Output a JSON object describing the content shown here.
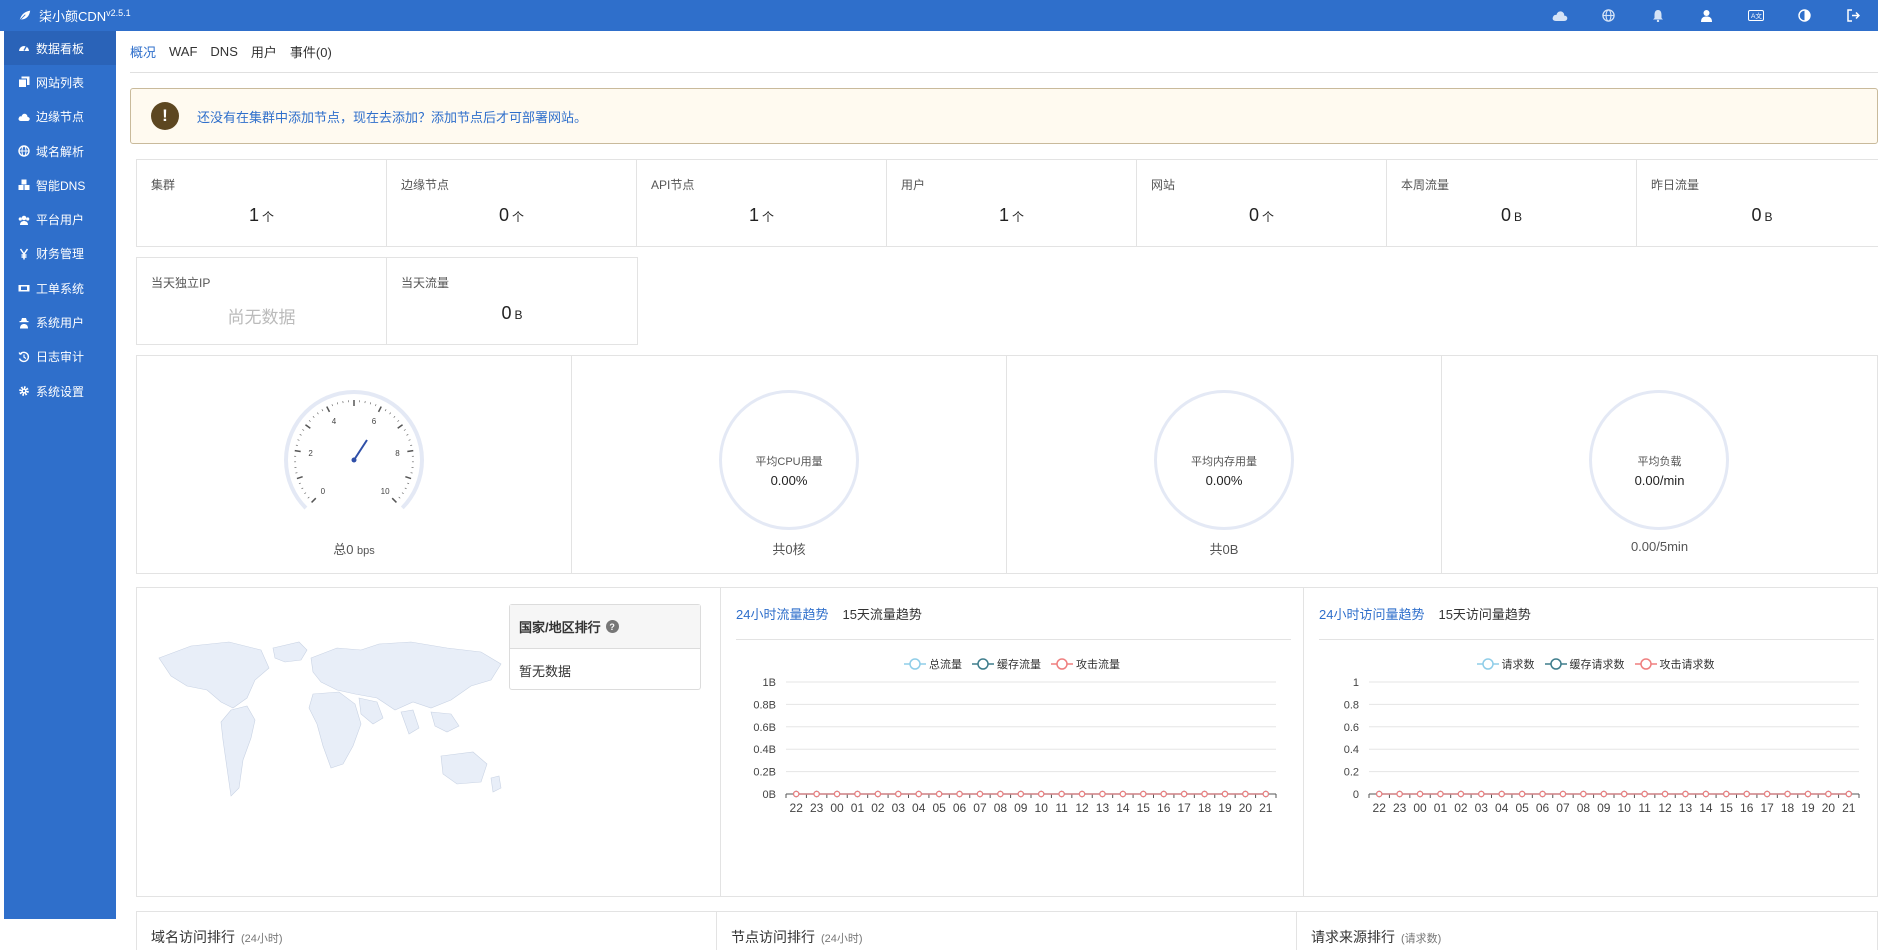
{
  "app": {
    "name": "柒小颜CDN",
    "version": "v2.5.1",
    "brand_color": "#2f6fcb"
  },
  "topbar": {
    "icons": [
      "cloud-icon",
      "globe-icon",
      "bell-icon",
      "user-icon",
      "language-icon",
      "theme-icon",
      "logout-icon"
    ]
  },
  "sidebar": {
    "items": [
      {
        "label": "数据看板",
        "icon": "dashboard-icon",
        "active": true
      },
      {
        "label": "网站列表",
        "icon": "copy-icon"
      },
      {
        "label": "边缘节点",
        "icon": "cloud-icon"
      },
      {
        "label": "域名解析",
        "icon": "globe-icon"
      },
      {
        "label": "智能DNS",
        "icon": "cubes-icon"
      },
      {
        "label": "平台用户",
        "icon": "users-icon"
      },
      {
        "label": "财务管理",
        "icon": "yen-icon"
      },
      {
        "label": "工单系统",
        "icon": "ticket-icon"
      },
      {
        "label": "系统用户",
        "icon": "user-secret-icon"
      },
      {
        "label": "日志审计",
        "icon": "history-icon"
      },
      {
        "label": "系统设置",
        "icon": "gear-icon"
      }
    ]
  },
  "tabs": [
    {
      "label": "概况",
      "active": true
    },
    {
      "label": "WAF"
    },
    {
      "label": "DNS"
    },
    {
      "label": "用户"
    },
    {
      "label": "事件(0)"
    }
  ],
  "notice": {
    "icon": "!",
    "text": "还没有在集群中添加节点，现在去添加？添加节点后才可部署网站。"
  },
  "stats_row1": [
    {
      "label": "集群",
      "value": "1",
      "unit": "个"
    },
    {
      "label": "边缘节点",
      "value": "0",
      "unit": "个"
    },
    {
      "label": "API节点",
      "value": "1",
      "unit": "个"
    },
    {
      "label": "用户",
      "value": "1",
      "unit": "个"
    },
    {
      "label": "网站",
      "value": "0",
      "unit": "个"
    },
    {
      "label": "本周流量",
      "value": "0",
      "unit": "B"
    },
    {
      "label": "昨日流量",
      "value": "0",
      "unit": "B"
    }
  ],
  "stats_row2": [
    {
      "label": "当天独立IP",
      "empty": "尚无数据"
    },
    {
      "label": "当天流量",
      "value": "0",
      "unit": "B"
    }
  ],
  "gauges": {
    "bandwidth": {
      "foot_prefix": "总0",
      "foot_unit": "bps",
      "ticks": [
        "0",
        "2",
        "4",
        "6",
        "8",
        "10"
      ],
      "value": 0
    },
    "cpu": {
      "label": "平均CPU用量",
      "value": "0.00%",
      "foot": "共0核"
    },
    "memory": {
      "label": "平均内存用量",
      "value": "0.00%",
      "foot": "共0B"
    },
    "load": {
      "label": "平均负载",
      "value": "0.00/min",
      "foot": "0.00/5min"
    }
  },
  "region_rank": {
    "title": "国家/地区排行",
    "help_icon": "?",
    "empty": "暂无数据"
  },
  "traffic_chart": {
    "tabs": [
      "24小时流量趋势",
      "15天流量趋势"
    ],
    "legend": [
      "总流量",
      "缓存流量",
      "攻击流量"
    ]
  },
  "request_chart": {
    "tabs": [
      "24小时访问量趋势",
      "15天访问量趋势"
    ],
    "legend": [
      "请求数",
      "缓存请求数",
      "攻击请求数"
    ]
  },
  "chart_data": [
    {
      "type": "line",
      "title": "24小时流量趋势",
      "x": [
        "22",
        "23",
        "00",
        "01",
        "02",
        "03",
        "04",
        "05",
        "06",
        "07",
        "08",
        "09",
        "10",
        "11",
        "12",
        "13",
        "14",
        "15",
        "16",
        "17",
        "18",
        "19",
        "20",
        "21"
      ],
      "yticks": [
        "0B",
        "0.2B",
        "0.4B",
        "0.6B",
        "0.8B",
        "1B"
      ],
      "ylim": [
        0,
        1
      ],
      "series": [
        {
          "name": "总流量",
          "color": "#8fcde8",
          "values": [
            0,
            0,
            0,
            0,
            0,
            0,
            0,
            0,
            0,
            0,
            0,
            0,
            0,
            0,
            0,
            0,
            0,
            0,
            0,
            0,
            0,
            0,
            0,
            0
          ]
        },
        {
          "name": "缓存流量",
          "color": "#3e7d8c",
          "values": [
            0,
            0,
            0,
            0,
            0,
            0,
            0,
            0,
            0,
            0,
            0,
            0,
            0,
            0,
            0,
            0,
            0,
            0,
            0,
            0,
            0,
            0,
            0,
            0
          ]
        },
        {
          "name": "攻击流量",
          "color": "#ef7f7f",
          "values": [
            0,
            0,
            0,
            0,
            0,
            0,
            0,
            0,
            0,
            0,
            0,
            0,
            0,
            0,
            0,
            0,
            0,
            0,
            0,
            0,
            0,
            0,
            0,
            0
          ]
        }
      ]
    },
    {
      "type": "line",
      "title": "24小时访问量趋势",
      "x": [
        "22",
        "23",
        "00",
        "01",
        "02",
        "03",
        "04",
        "05",
        "06",
        "07",
        "08",
        "09",
        "10",
        "11",
        "12",
        "13",
        "14",
        "15",
        "16",
        "17",
        "18",
        "19",
        "20",
        "21"
      ],
      "yticks": [
        "0",
        "0.2",
        "0.4",
        "0.6",
        "0.8",
        "1"
      ],
      "ylim": [
        0,
        1
      ],
      "series": [
        {
          "name": "请求数",
          "color": "#8fcde8",
          "values": [
            0,
            0,
            0,
            0,
            0,
            0,
            0,
            0,
            0,
            0,
            0,
            0,
            0,
            0,
            0,
            0,
            0,
            0,
            0,
            0,
            0,
            0,
            0,
            0
          ]
        },
        {
          "name": "缓存请求数",
          "color": "#3e7d8c",
          "values": [
            0,
            0,
            0,
            0,
            0,
            0,
            0,
            0,
            0,
            0,
            0,
            0,
            0,
            0,
            0,
            0,
            0,
            0,
            0,
            0,
            0,
            0,
            0,
            0
          ]
        },
        {
          "name": "攻击请求数",
          "color": "#ef7f7f",
          "values": [
            0,
            0,
            0,
            0,
            0,
            0,
            0,
            0,
            0,
            0,
            0,
            0,
            0,
            0,
            0,
            0,
            0,
            0,
            0,
            0,
            0,
            0,
            0,
            0
          ]
        }
      ]
    }
  ],
  "rankings": [
    {
      "title": "域名访问排行",
      "sub": "(24小时)"
    },
    {
      "title": "节点访问排行",
      "sub": "(24小时)"
    },
    {
      "title": "请求来源排行",
      "sub": "(请求数)"
    }
  ]
}
